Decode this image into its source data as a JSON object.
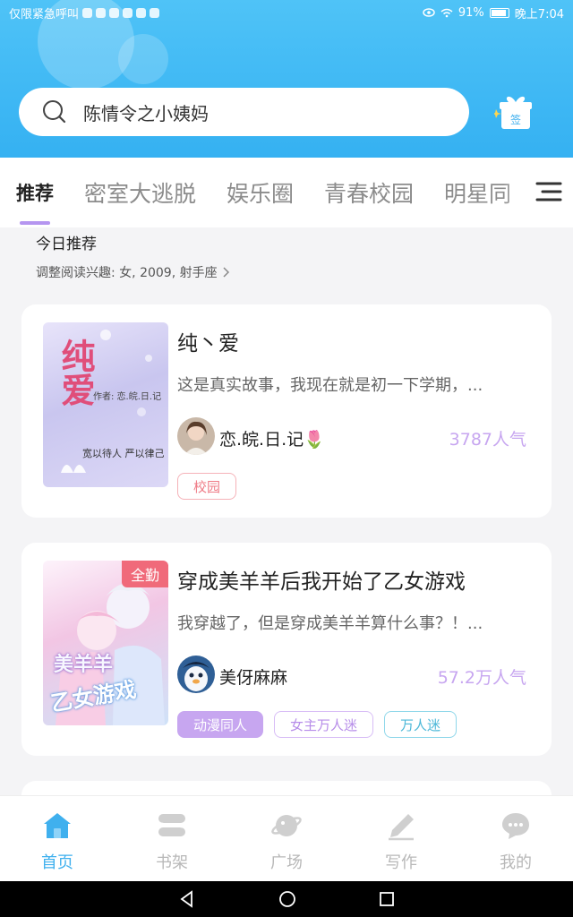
{
  "status_bar": {
    "left_text": "仅限紧急呼叫",
    "battery_percent": "91%",
    "time": "晚上7:04"
  },
  "search": {
    "text": "陈情令之小姨妈",
    "icon": "search-icon"
  },
  "signin": {
    "label": "签",
    "icon": "gift-icon"
  },
  "tabs": [
    {
      "label": "推荐",
      "active": true
    },
    {
      "label": "密室大逃脱",
      "active": false
    },
    {
      "label": "娱乐圈",
      "active": false
    },
    {
      "label": "青春校园",
      "active": false
    },
    {
      "label": "明星同",
      "active": false
    }
  ],
  "section": {
    "title": "今日推荐",
    "interest": "调整阅读兴趣: 女, 2009, 射手座"
  },
  "books": [
    {
      "title": "纯丶爱",
      "description": "这是真实故事，我现在就是初一下学期，...",
      "author": "恋.皖.日.记🌷",
      "popularity": "3787人气",
      "tags": [
        "校园"
      ],
      "cover": {
        "title": "纯爱",
        "note1": "作者: 恋.皖.日.记",
        "note2": "宽以待人 严以律己"
      },
      "badge": ""
    },
    {
      "title": "穿成美羊羊后我开始了乙女游戏",
      "description": "我穿越了，但是穿成美羊羊算什么事？！...",
      "author": "美伢麻麻",
      "popularity": "57.2万人气",
      "tags": [
        "动漫同人",
        "女主万人迷",
        "万人迷"
      ],
      "cover": {
        "title": "美羊羊",
        "subtitle": "乙女游戏"
      },
      "badge": "全勤"
    }
  ],
  "bottom_nav": [
    {
      "label": "首页",
      "icon": "home-icon",
      "active": true
    },
    {
      "label": "书架",
      "icon": "bookshelf-icon",
      "active": false
    },
    {
      "label": "广场",
      "icon": "planet-icon",
      "active": false
    },
    {
      "label": "写作",
      "icon": "pen-icon",
      "active": false
    },
    {
      "label": "我的",
      "icon": "chat-bubble-icon",
      "active": false
    }
  ],
  "colors": {
    "header_blue": "#3fb8f4",
    "accent_purple": "#c7a6f0",
    "active_nav_blue": "#3fb0ee"
  }
}
